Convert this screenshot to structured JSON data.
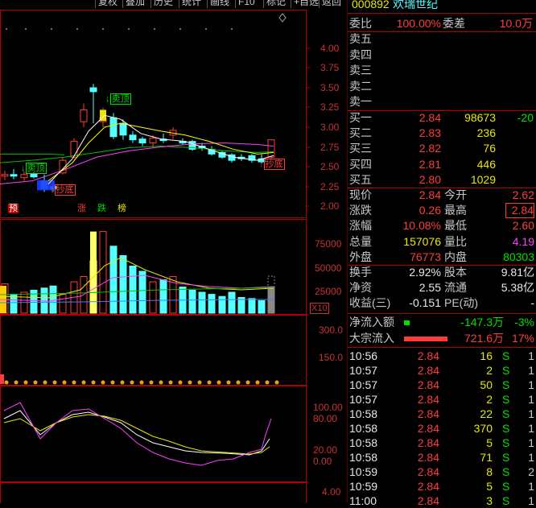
{
  "toolbar": {
    "buttons": [
      "复权",
      "叠加",
      "历史",
      "统计",
      "画线",
      "F10",
      "标记",
      "+自选",
      "返回"
    ]
  },
  "stock": {
    "code": "000892",
    "name": "欢瑞世纪"
  },
  "main_axis": {
    "ticks": [
      "4.00",
      "3.75",
      "3.50",
      "3.25",
      "3.00",
      "2.75",
      "2.50",
      "2.25",
      "2.00"
    ]
  },
  "volume_axis": {
    "ticks": [
      "75000",
      "50000",
      "25000"
    ],
    "unit": "X10"
  },
  "indicator_axis": {
    "ticks": [
      "300.0",
      "150.0"
    ]
  },
  "kdj_axis": {
    "ticks": [
      "100.00",
      "80.00",
      "20.00",
      "0.00"
    ]
  },
  "bottom_axis": {
    "ticks": [
      "4.00"
    ]
  },
  "signals": {
    "sell_top_1": "卖顶",
    "sell_top_2": "卖顶",
    "buy_bottom_1": "抄底",
    "buy_bottom_2": "抄底",
    "marks": [
      "预",
      "涨",
      "跌",
      "榜"
    ]
  },
  "colors": {
    "up": "#ff3c3c",
    "down": "#54ffff",
    "ma5": "#ffffff",
    "ma10": "#ffff00",
    "ma20": "#ff40ff",
    "ma60": "#00c000",
    "border": "#b00000"
  },
  "order_ratio": {
    "weibi_label": "委比",
    "weibi": "100.00%",
    "weicha_label": "委差",
    "weicha": "10.0万"
  },
  "asks": [
    {
      "label": "卖五",
      "price": "",
      "vol": ""
    },
    {
      "label": "卖四",
      "price": "",
      "vol": ""
    },
    {
      "label": "卖三",
      "price": "",
      "vol": ""
    },
    {
      "label": "卖二",
      "price": "",
      "vol": ""
    },
    {
      "label": "卖一",
      "price": "",
      "vol": ""
    }
  ],
  "bids": [
    {
      "label": "买一",
      "price": "2.84",
      "vol": "98673",
      "chg": "-20"
    },
    {
      "label": "买二",
      "price": "2.83",
      "vol": "236",
      "chg": ""
    },
    {
      "label": "买三",
      "price": "2.82",
      "vol": "76",
      "chg": ""
    },
    {
      "label": "买四",
      "price": "2.81",
      "vol": "446",
      "chg": ""
    },
    {
      "label": "买五",
      "price": "2.80",
      "vol": "1029",
      "chg": ""
    }
  ],
  "quote": [
    {
      "l1": "现价",
      "v1": "2.84",
      "l2": "今开",
      "v2": "2.62",
      "c1": "red",
      "c2": "red"
    },
    {
      "l1": "涨跌",
      "v1": "0.26",
      "l2": "最高",
      "v2": "2.84",
      "c1": "red",
      "c2": "red"
    },
    {
      "l1": "涨幅",
      "v1": "10.08%",
      "l2": "最低",
      "v2": "2.60",
      "c1": "red",
      "c2": "red"
    },
    {
      "l1": "总量",
      "v1": "157076",
      "l2": "量比",
      "v2": "4.19",
      "c1": "yellow",
      "c2": "mag"
    },
    {
      "l1": "外盘",
      "v1": "76773",
      "l2": "内盘",
      "v2": "80303",
      "c1": "red",
      "c2": "green"
    }
  ],
  "fundamentals": [
    {
      "l1": "换手",
      "v1": "2.92%",
      "l2": "股本",
      "v2": "9.81亿"
    },
    {
      "l1": "净资",
      "v1": "2.55",
      "l2": "流通",
      "v2": "5.38亿"
    },
    {
      "l1": "收益(三)",
      "v1": "-0.151",
      "l2": "PE(动)",
      "v2": "-"
    }
  ],
  "flows": [
    {
      "label": "净流入额",
      "value": "-147.3万",
      "pct": "-3%",
      "bar_fraction": 0.12,
      "color": "#00e000"
    },
    {
      "label": "大宗流入",
      "value": "721.6万",
      "pct": "17%",
      "bar_fraction": 0.9,
      "color": "#ff3c3c"
    }
  ],
  "ticks": [
    {
      "time": "10:56",
      "price": "2.84",
      "vol": "16",
      "side": "S",
      "n": "1"
    },
    {
      "time": "10:57",
      "price": "2.84",
      "vol": "2",
      "side": "S",
      "n": "1"
    },
    {
      "time": "10:57",
      "price": "2.84",
      "vol": "50",
      "side": "S",
      "n": "1"
    },
    {
      "time": "10:57",
      "price": "2.84",
      "vol": "2",
      "side": "S",
      "n": "1"
    },
    {
      "time": "10:58",
      "price": "2.84",
      "vol": "22",
      "side": "S",
      "n": "1"
    },
    {
      "time": "10:58",
      "price": "2.84",
      "vol": "370",
      "side": "S",
      "n": "1"
    },
    {
      "time": "10:58",
      "price": "2.84",
      "vol": "5",
      "side": "S",
      "n": "1"
    },
    {
      "time": "10:58",
      "price": "2.84",
      "vol": "71",
      "side": "S",
      "n": "1"
    },
    {
      "time": "10:59",
      "price": "2.84",
      "vol": "8",
      "side": "S",
      "n": "2"
    },
    {
      "time": "10:59",
      "price": "2.84",
      "vol": "5",
      "side": "S",
      "n": "1"
    },
    {
      "time": "11:00",
      "price": "2.84",
      "vol": "3",
      "side": "S",
      "n": "1"
    }
  ]
}
